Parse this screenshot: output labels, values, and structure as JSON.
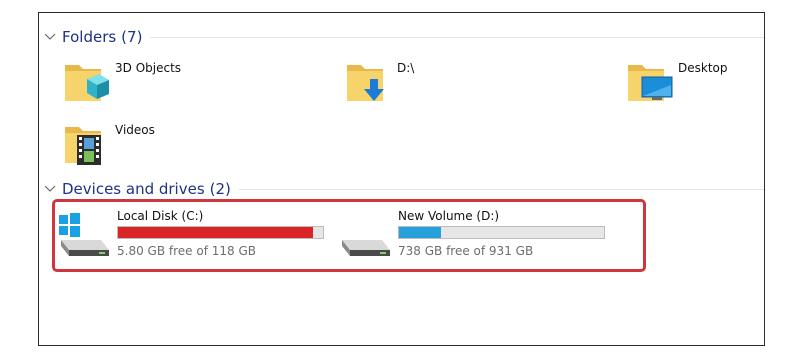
{
  "folders_group": {
    "title": "Folders",
    "count": "(7)",
    "items": [
      {
        "label": "3D Objects"
      },
      {
        "label": "D:\\"
      },
      {
        "label": "Desktop"
      },
      {
        "label": "Videos"
      }
    ]
  },
  "drives_group": {
    "title": "Devices and drives",
    "count": "(2)",
    "items": [
      {
        "name": "Local Disk (C:)",
        "free_text": "5.80 GB free of 118 GB",
        "used_fraction": 0.951,
        "bar_color": "#da2526",
        "icon": "windows-drive-icon"
      },
      {
        "name": "New Volume (D:)",
        "free_text": "738 GB free of 931 GB",
        "used_fraction": 0.207,
        "bar_color": "#26a0da",
        "icon": "hard-drive-icon"
      }
    ]
  },
  "colors": {
    "group_header": "#1e3287",
    "highlight_border": "#d0363c",
    "drive_bar_track": "#e6e6e6"
  }
}
